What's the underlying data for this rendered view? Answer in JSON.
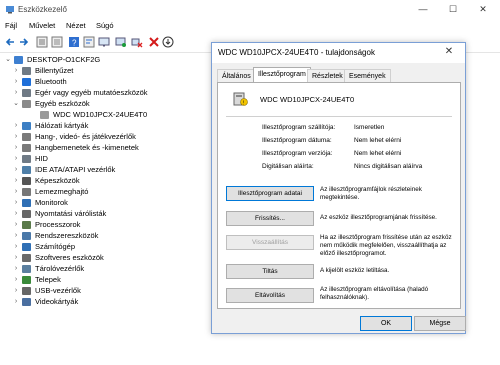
{
  "window": {
    "title": "Eszközkezelő",
    "minimize": "—",
    "maximize": "☐",
    "close": "✕"
  },
  "menu": {
    "items": [
      "Fájl",
      "Művelet",
      "Nézet",
      "Súgó"
    ]
  },
  "tree": {
    "root": "DESKTOP-O1CKF2G",
    "items": [
      {
        "label": "Billentyűzet",
        "chevron": "›",
        "color": "#6f7a85"
      },
      {
        "label": "Bluetooth",
        "chevron": "›",
        "color": "#1e6fd9"
      },
      {
        "label": "Egér vagy egyéb mutatóeszközök",
        "chevron": "›",
        "color": "#6f7a85"
      },
      {
        "label": "Egyéb eszközök",
        "chevron": "⌄",
        "color": "#8a8a8a"
      },
      {
        "label": "WDC WD10JPCX-24UE4T0",
        "chevron": "",
        "color": "#9a9a9a",
        "child": true
      },
      {
        "label": "Hálózati kártyák",
        "chevron": "›",
        "color": "#3c7fc4"
      },
      {
        "label": "Hang-, videó- és játékvezérlők",
        "chevron": "›",
        "color": "#7a7a7a"
      },
      {
        "label": "Hangbemenetek és -kimenetek",
        "chevron": "›",
        "color": "#7a7a7a"
      },
      {
        "label": "HID",
        "chevron": "›",
        "color": "#6f7a85"
      },
      {
        "label": "IDE ATA/ATAPI vezérlők",
        "chevron": "›",
        "color": "#4f7fa8"
      },
      {
        "label": "Képeszközök",
        "chevron": "›",
        "color": "#555"
      },
      {
        "label": "Lemezmeghajtó",
        "chevron": "›",
        "color": "#777"
      },
      {
        "label": "Monitorok",
        "chevron": "›",
        "color": "#2f6fb5"
      },
      {
        "label": "Nyomtatási várólisták",
        "chevron": "›",
        "color": "#666"
      },
      {
        "label": "Processzorok",
        "chevron": "›",
        "color": "#5a7a4a"
      },
      {
        "label": "Rendszereszközök",
        "chevron": "›",
        "color": "#4a78a8"
      },
      {
        "label": "Számítógép",
        "chevron": "›",
        "color": "#2f6fb5"
      },
      {
        "label": "Szoftveres eszközök",
        "chevron": "›",
        "color": "#6a6a6a"
      },
      {
        "label": "Tárolóvezérlők",
        "chevron": "›",
        "color": "#5b7f9f"
      },
      {
        "label": "Telepek",
        "chevron": "›",
        "color": "#3a8a3a"
      },
      {
        "label": "USB-vezérlők",
        "chevron": "›",
        "color": "#666"
      },
      {
        "label": "Videokártyák",
        "chevron": "›",
        "color": "#4a6fa0"
      }
    ]
  },
  "dialog": {
    "title": "WDC WD10JPCX-24UE4T0 - tulajdonságok",
    "close": "✕",
    "tabs": [
      "Általános",
      "Illesztőprogram",
      "Részletek",
      "Események"
    ],
    "device_name": "WDC WD10JPCX-24UE4T0",
    "properties": [
      {
        "label": "Illesztőprogram szállítója:",
        "value": "Ismeretlen"
      },
      {
        "label": "Illesztőprogram dátuma:",
        "value": "Nem lehet elérni"
      },
      {
        "label": "Illesztőprogram verziója:",
        "value": "Nem lehet elérni"
      },
      {
        "label": "Digitálisan aláírta:",
        "value": "Nincs digitálisan aláírva"
      }
    ],
    "actions": [
      {
        "button": "Illesztőprogram adatai",
        "desc": "Az illesztőprogramfájlok részleteinek megtekintése."
      },
      {
        "button": "Frissítés...",
        "desc": "Az eszköz illesztőprogramjának frissítése."
      },
      {
        "button": "Visszaállítás",
        "desc": "Ha az illesztőprogram frissítése után az eszköz nem működik megfelelően, visszaállíthatja az előző illesztőprogramot."
      },
      {
        "button": "Tiltás",
        "desc": "A kijelölt eszköz letiltása."
      },
      {
        "button": "Eltávolítás",
        "desc": "Az illesztőprogram eltávolítása (haladó felhasználóknak)."
      }
    ],
    "ok": "OK",
    "cancel": "Mégse"
  }
}
